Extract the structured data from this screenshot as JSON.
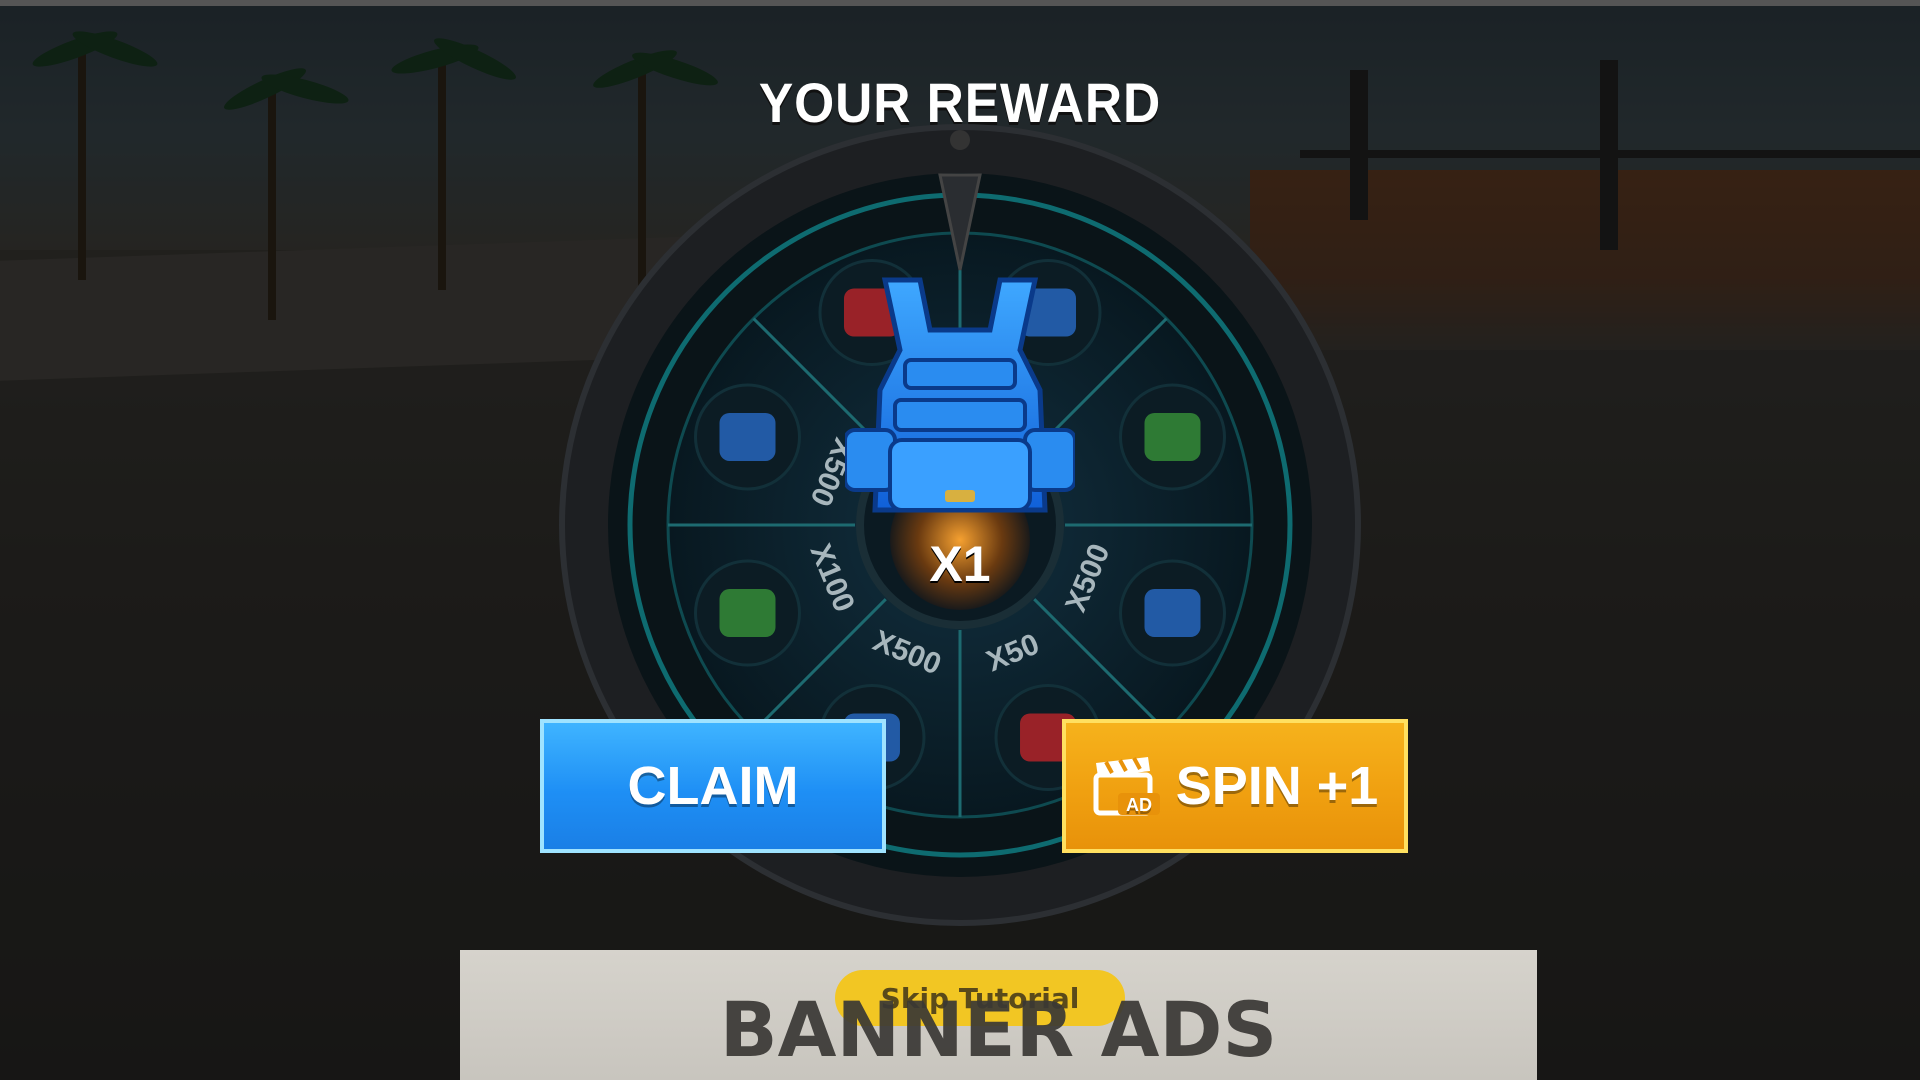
{
  "header": {
    "title": "YOUR REWARD"
  },
  "wheel": {
    "segments": [
      {
        "item": "armor-vest",
        "label": ""
      },
      {
        "item": "cash",
        "label": ""
      },
      {
        "item": "armor-vest",
        "label": "X500"
      },
      {
        "item": "medkit",
        "label": "X50"
      },
      {
        "item": "armor-vest",
        "label": "X500"
      },
      {
        "item": "cash",
        "label": "X100"
      },
      {
        "item": "armor-vest",
        "label": "X500"
      },
      {
        "item": "medkit",
        "label": "X50"
      }
    ],
    "reward": {
      "item": "armor-vest",
      "quantity": "X1"
    },
    "colors": {
      "rim": "#1d1f22",
      "ring": "#0e6b70",
      "inner": "#0b1a22",
      "glow": "#1fb3d8"
    }
  },
  "buttons": {
    "claim": {
      "label": "CLAIM",
      "color": "#2196f3"
    },
    "spin": {
      "label": "SPIN +1",
      "icon": "clapperboard-ad-icon",
      "icon_text": "AD",
      "color": "#f2a516"
    }
  },
  "banner": {
    "text": "BANNER ADS",
    "skip_label": "Skip Tutorial"
  }
}
